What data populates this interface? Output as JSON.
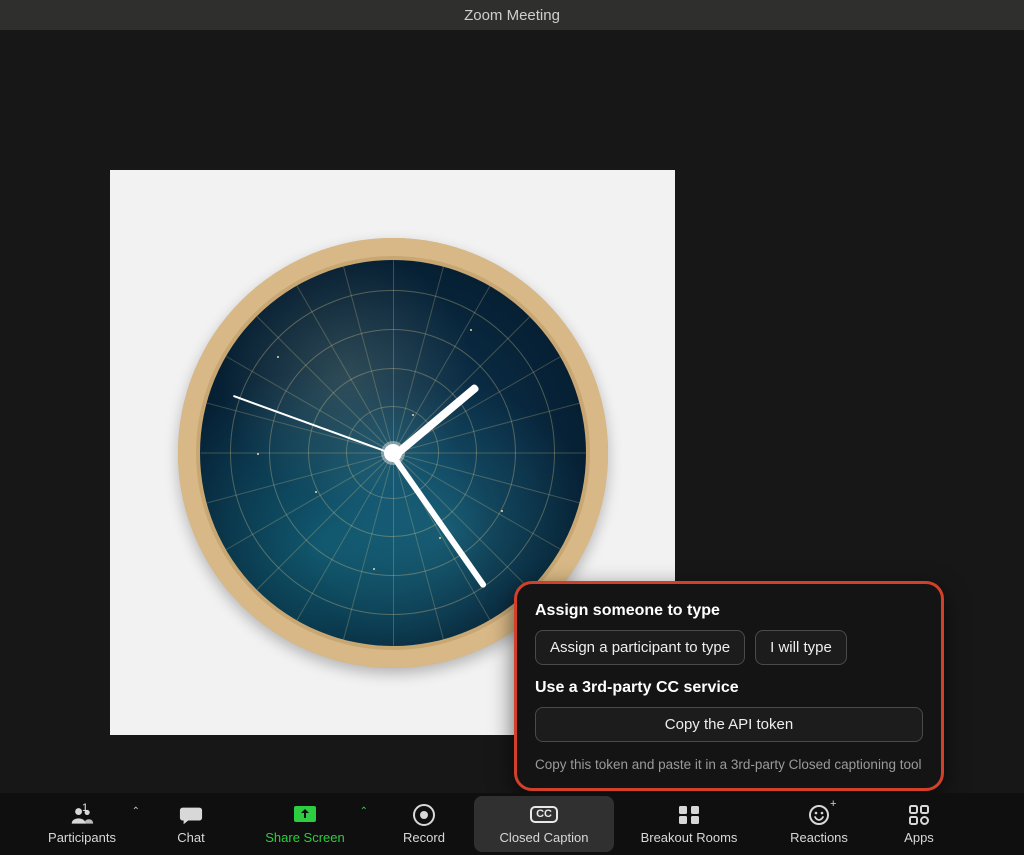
{
  "window": {
    "title": "Zoom Meeting"
  },
  "popup": {
    "section1_title": "Assign someone to type",
    "assign_btn": "Assign a participant to type",
    "self_btn": "I will type",
    "section2_title": "Use a 3rd-party CC service",
    "copy_btn": "Copy the API token",
    "hint": "Copy this token and paste it in a 3rd-party Closed captioning tool"
  },
  "toolbar": {
    "participants": {
      "label": "Participants",
      "count": "1"
    },
    "chat": {
      "label": "Chat"
    },
    "share": {
      "label": "Share Screen"
    },
    "record": {
      "label": "Record"
    },
    "cc": {
      "label": "Closed Caption",
      "badge": "CC"
    },
    "breakout": {
      "label": "Breakout Rooms"
    },
    "reactions": {
      "label": "Reactions"
    },
    "apps": {
      "label": "Apps"
    }
  },
  "watermark": ""
}
